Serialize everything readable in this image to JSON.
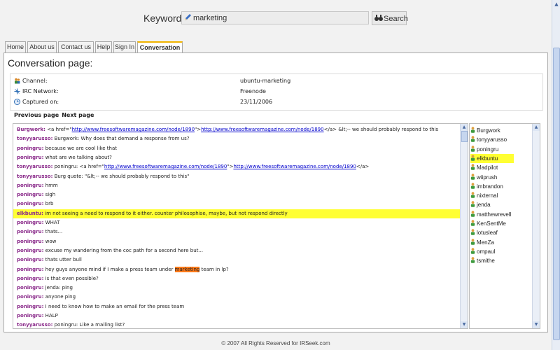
{
  "search": {
    "keyword_label": "Keyword:",
    "value": "marketing",
    "button_label": "Search"
  },
  "tabs": [
    {
      "label": "Home"
    },
    {
      "label": "About us"
    },
    {
      "label": "Contact us"
    },
    {
      "label": "Help"
    },
    {
      "label": "Sign In"
    },
    {
      "label": "Conversation",
      "active": true
    }
  ],
  "page": {
    "title": "Conversation page:"
  },
  "info": {
    "channel_label": "Channel:",
    "channel_value": "ubuntu-marketing",
    "network_label": "IRC Network:",
    "network_value": "Freenode",
    "captured_label": "Captured on:",
    "captured_value": "23/11/2006"
  },
  "nav": {
    "previous": "Previous page",
    "next": "Next page"
  },
  "log": [
    {
      "nick": "Burgwork:",
      "parts": [
        {
          "t": " <a href=\""
        },
        {
          "link": "http://www.freesoftwaremagazine.com/node/1890"
        },
        {
          "t": "\">"
        },
        {
          "link": "http://www.freesoftwaremagazine.com/node/1890"
        },
        {
          "t": "</a> &lt;-- we should probably respond to this"
        }
      ]
    },
    {
      "nick": "tonyyarusso:",
      "parts": [
        {
          "t": " Burgwork: Why does that demand a response from us?"
        }
      ]
    },
    {
      "nick": "poningru:",
      "parts": [
        {
          "t": " because we are cool like that"
        }
      ]
    },
    {
      "nick": "poningru:",
      "parts": [
        {
          "t": " what are we talking about?"
        }
      ]
    },
    {
      "nick": "tonyyarusso:",
      "parts": [
        {
          "t": " poningru: <a href=\""
        },
        {
          "link": "http://www.freesoftwaremagazine.com/node/1890"
        },
        {
          "t": "\">"
        },
        {
          "link": "http://www.freesoftwaremagazine.com/node/1890"
        },
        {
          "t": "</a>"
        }
      ]
    },
    {
      "nick": "tonyyarusso:",
      "parts": [
        {
          "t": " Burg quote: \"&lt;-- we should probably respond to this\""
        }
      ]
    },
    {
      "nick": "poningru:",
      "parts": [
        {
          "t": " hmm"
        }
      ]
    },
    {
      "nick": "poningru:",
      "parts": [
        {
          "t": " sigh"
        }
      ]
    },
    {
      "nick": "poningru:",
      "parts": [
        {
          "t": " brb"
        }
      ]
    },
    {
      "nick": "elkbuntu:",
      "highlight": true,
      "parts": [
        {
          "t": " im not seeing a need to respond to it either. counter philosophise, maybe, but not respond directly"
        }
      ]
    },
    {
      "nick": "poningru:",
      "parts": [
        {
          "t": " WHAT"
        }
      ]
    },
    {
      "nick": "poningru:",
      "parts": [
        {
          "t": " thats..."
        }
      ]
    },
    {
      "nick": "poningru:",
      "parts": [
        {
          "t": " wow"
        }
      ]
    },
    {
      "nick": "poningru:",
      "parts": [
        {
          "t": " excuse my wandering from the coc path for a second here but..."
        }
      ]
    },
    {
      "nick": "poningru:",
      "parts": [
        {
          "t": " thats utter bull"
        }
      ]
    },
    {
      "nick": "poningru:",
      "parts": [
        {
          "t": " hey guys anyone mind if I make a press team under "
        },
        {
          "kw": "marketing"
        },
        {
          "t": " team in lp?"
        }
      ]
    },
    {
      "nick": "poningru:",
      "parts": [
        {
          "t": " is that even possible?"
        }
      ]
    },
    {
      "nick": "poningru:",
      "parts": [
        {
          "t": " jenda: ping"
        }
      ]
    },
    {
      "nick": "poningru:",
      "parts": [
        {
          "t": " anyone ping"
        }
      ]
    },
    {
      "nick": "poningru:",
      "parts": [
        {
          "t": " I need to know how to make an email for the press team"
        }
      ]
    },
    {
      "nick": "poningru:",
      "parts": [
        {
          "t": " HALP"
        }
      ]
    },
    {
      "nick": "tonyyarusso:",
      "parts": [
        {
          "t": " poningru: Like a mailing list?"
        }
      ]
    }
  ],
  "users": [
    {
      "name": "Burgwork"
    },
    {
      "name": "tonyyarusso"
    },
    {
      "name": "poningru"
    },
    {
      "name": "elkbuntu",
      "highlight": true
    },
    {
      "name": "Madpilot"
    },
    {
      "name": "wiiprush"
    },
    {
      "name": "imbrandon"
    },
    {
      "name": "nixternal"
    },
    {
      "name": "jenda"
    },
    {
      "name": "matthewrevell"
    },
    {
      "name": "KenSentMe"
    },
    {
      "name": "lotusleaf"
    },
    {
      "name": "MenZa"
    },
    {
      "name": "ompaul"
    },
    {
      "name": "tsmithe"
    }
  ],
  "footer": {
    "text": "© 2007 All Rights Reserved for IRSeek.com"
  },
  "colors": {
    "highlight": "#ffff33",
    "keyword_highlight": "#ff7a1a",
    "nick": "#8a2a8a",
    "link": "#0000cc",
    "active_tab_border": "#f0b400"
  },
  "icons": {
    "channel": "people-icon",
    "network": "network-icon",
    "captured": "clock-icon",
    "user": "user-icon",
    "search": "binoculars-icon",
    "keyword": "pencil-icon"
  }
}
